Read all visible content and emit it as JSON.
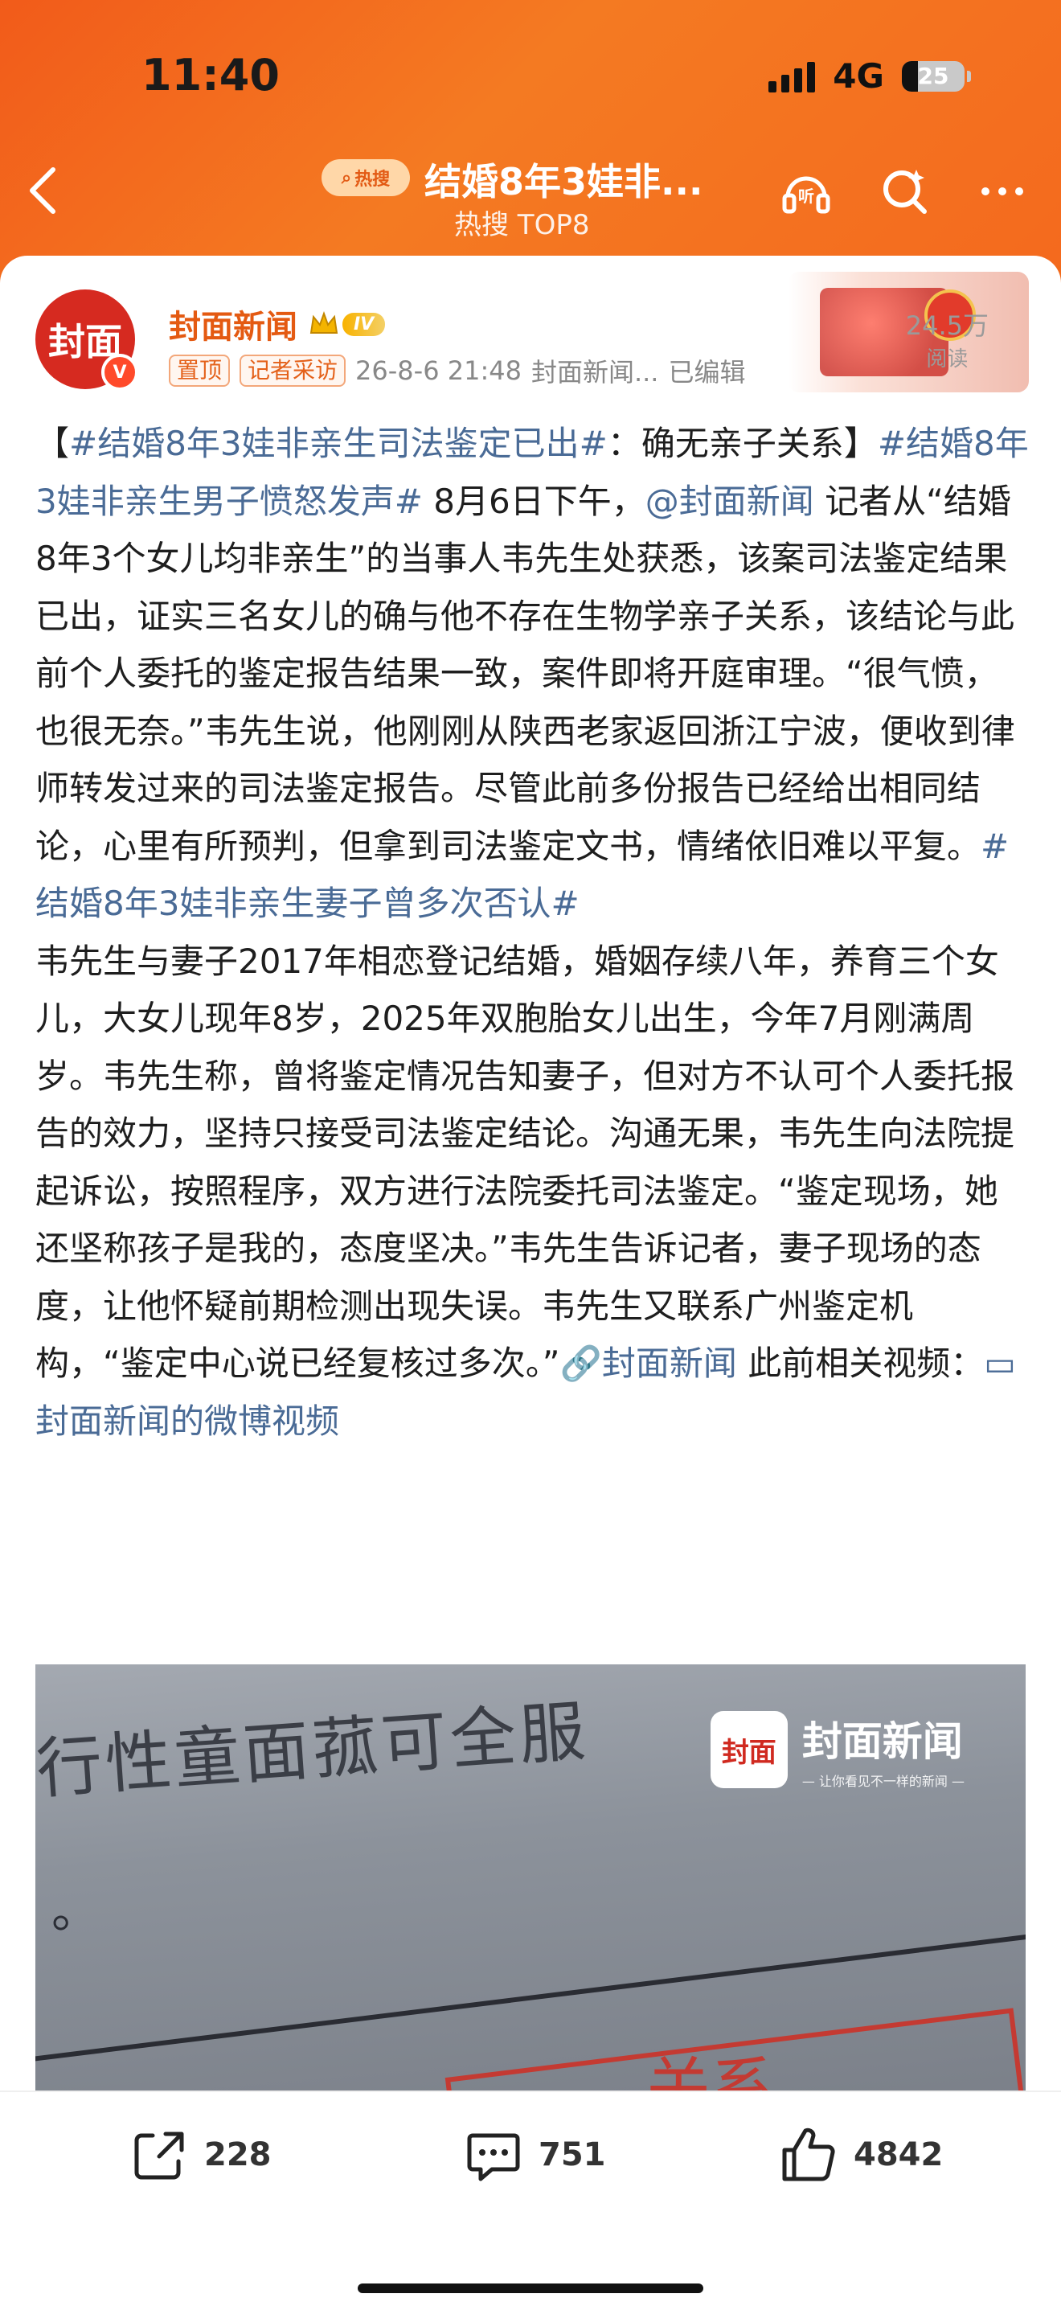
{
  "status_bar": {
    "time": "11:40",
    "network": "4G",
    "battery": "25"
  },
  "nav": {
    "hot_badge": "热搜",
    "title": "结婚8年3娃非...",
    "subtitle": "热搜 TOP8",
    "listen_label": "听"
  },
  "post": {
    "author": "封面新闻",
    "avatar_text": "封面",
    "verified_mark": "V",
    "level": "IV",
    "tags": [
      "置顶",
      "记者采访"
    ],
    "timestamp": "26-8-6 21:48",
    "source": "封面新闻...",
    "edited": "已编辑",
    "reads_count": "24.5万",
    "reads_label": "阅读",
    "content": {
      "p1_bracket_open": "【",
      "p1_tag1": "#结婚8年3娃非亲生司法鉴定已出#",
      "p1_title_rest": "：确无亲子关系】",
      "p1_tag2": "#结婚8年3娃非亲生男子愤怒发声#",
      "p1_text1": " 8月6日下午，",
      "p1_mention": "@封面新闻",
      "p1_text2": " 记者从“结婚8年3个女儿均非亲生”的当事人韦先生处获悉，该案司法鉴定结果已出，证实三名女儿的确与他不存在生物学亲子关系，该结论与此前个人委托的鉴定报告结果一致，案件即将开庭审理。“很气愤，也很无奈。”韦先生说，他刚刚从陕西老家返回浙江宁波，便收到律师转发过来的司法鉴定报告。尽管此前多份报告已经给出相同结论，心里有所预判，但拿到司法鉴定文书，情绪依旧难以平复。",
      "p1_tag3": "#结婚8年3娃非亲生妻子曾多次否认#",
      "p2_text": "韦先生与妻子2017年相恋登记结婚，婚姻存续八年，养育三个女儿，大女儿现年8岁，2025年双胞胎女儿出生，今年7月刚满周岁。韦先生称，曾将鉴定情况告知妻子，但对方不认可个人委托报告的效力，坚持只接受司法鉴定结论。沟通无果，韦先生向法院提起诉讼，按照程序，双方进行法院委托司法鉴定。“鉴定现场，她还坚称孩子是我的，态度坚决。”韦先生告诉记者，妻子现场的态度，让他怀疑前期检测出现失误。韦先生又联系广州鉴定机构，“鉴定中心说已经复核过多次。”",
      "p2_link": "封面新闻",
      "p2_text2": " 此前相关视频：",
      "p2_video_link": "封面新闻的微博视频"
    },
    "image": {
      "photo_text": "行性童面菰可全服",
      "photo_dot": "。",
      "stamp_text": "关系",
      "watermark_logo": "封面",
      "watermark_name": "封面新闻",
      "watermark_slogan": "— 让你看见不一样的新闻 —"
    }
  },
  "actions": {
    "repost": "228",
    "comment": "751",
    "like": "4842"
  },
  "colors": {
    "accent": "#f26a1b",
    "link": "#4a6b96",
    "author": "#e45a12"
  }
}
